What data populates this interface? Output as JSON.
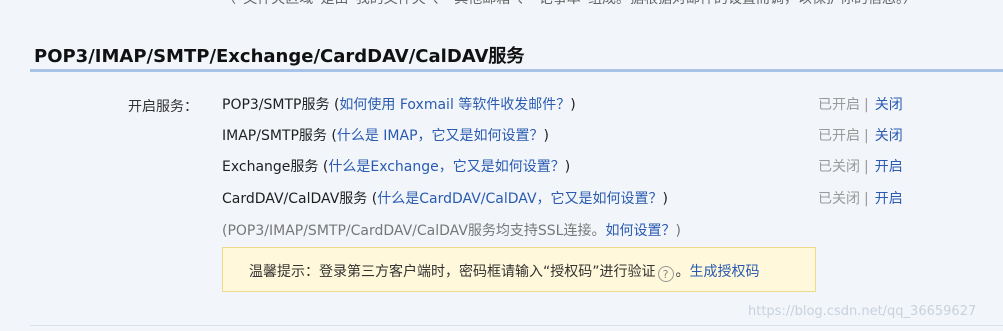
{
  "header": {
    "top_note": "（“文件夹区域”是由“我的文件夹”、“其他邮箱”、“记事本”组成。据根据对邮件的设置而调，以保护你的信息。）",
    "section_title": "POP3/IMAP/SMTP/Exchange/CardDAV/CalDAV服务"
  },
  "services": {
    "label": "开启服务：",
    "items": [
      {
        "name": "POP3/SMTP服务",
        "open_paren": " (",
        "link": "如何使用 Foxmail 等软件收发邮件？",
        "close_paren": ")",
        "status": "已开启",
        "action": "关闭"
      },
      {
        "name": "IMAP/SMTP服务",
        "open_paren": " (",
        "link": "什么是 IMAP，它又是如何设置？",
        "close_paren": ")",
        "status": "已开启",
        "action": "关闭"
      },
      {
        "name": "Exchange服务",
        "open_paren": " (",
        "link": "什么是Exchange，它又是如何设置？",
        "close_paren": ")",
        "status": "已关闭",
        "action": "开启"
      },
      {
        "name": "CardDAV/CalDAV服务",
        "open_paren": " (",
        "link": "什么是CardDAV/CalDAV，它又是如何设置？",
        "close_paren": ")",
        "status": "已关闭",
        "action": "开启"
      }
    ],
    "separator": "|"
  },
  "ssl_note": {
    "text": "(POP3/IMAP/SMTP/CardDAV/CalDAV服务均支持SSL连接。",
    "link": "如何设置？",
    "close": ")"
  },
  "tip": {
    "text": "温馨提示：登录第三方客户端时，密码框请输入“授权码”进行验证",
    "icon": "?",
    "link": "生成授权码"
  },
  "watermark": "https://blog.csdn.net/qq_36659627"
}
